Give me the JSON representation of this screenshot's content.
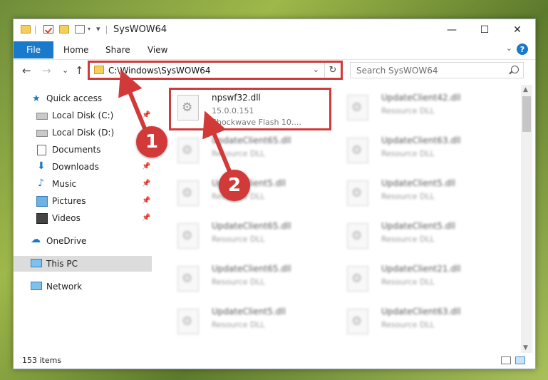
{
  "window": {
    "title": "SysWOW64",
    "controls": {
      "minimize": "—",
      "maximize": "☐",
      "close": "✕"
    }
  },
  "ribbon": {
    "tabs": [
      "File",
      "Home",
      "Share",
      "View"
    ],
    "collapse_glyph": "⌄",
    "help_glyph": "?"
  },
  "navigation": {
    "back": "←",
    "forward": "→",
    "recent": "⌄",
    "up": "↑",
    "address": "C:\\Windows\\SysWOW64",
    "address_dropdown": "⌄",
    "refresh": "↻",
    "search_placeholder": "Search SysWOW64"
  },
  "sidebar": {
    "items": [
      {
        "label": "Quick access",
        "icon": "star-icon",
        "pinned": false
      },
      {
        "label": "Local Disk (C:)",
        "icon": "drive-icon",
        "pinned": true
      },
      {
        "label": "Local Disk (D:)",
        "icon": "drive-icon",
        "pinned": false
      },
      {
        "label": "Documents",
        "icon": "document-icon",
        "pinned": false
      },
      {
        "label": "Downloads",
        "icon": "download-icon",
        "pinned": true
      },
      {
        "label": "Music",
        "icon": "music-icon",
        "pinned": true
      },
      {
        "label": "Pictures",
        "icon": "pictures-icon",
        "pinned": true
      },
      {
        "label": "Videos",
        "icon": "video-icon",
        "pinned": true
      },
      {
        "label": "OneDrive",
        "icon": "cloud-icon",
        "pinned": false
      },
      {
        "label": "This PC",
        "icon": "computer-icon",
        "pinned": false,
        "selected": true
      },
      {
        "label": "Network",
        "icon": "network-icon",
        "pinned": false
      }
    ],
    "pin_glyph": "📌"
  },
  "files": {
    "highlighted": {
      "name": "npswf32.dll",
      "version": "15.0.0.151",
      "description": "Shockwave Flash 10...."
    },
    "left_column": [
      {
        "name": "UpdateClient65.dll",
        "type": "Resource DLL"
      },
      {
        "name": "UpdateClient5.dll",
        "type": "Resource DLL"
      },
      {
        "name": "UpdateClient65.dll",
        "type": "Resource DLL"
      },
      {
        "name": "UpdateClient65.dll",
        "type": "Resource DLL"
      },
      {
        "name": "UpdateClient5.dll",
        "type": "Resource DLL"
      }
    ],
    "right_column": [
      {
        "name": "UpdateClient42.dll",
        "type": "Resource DLL"
      },
      {
        "name": "UpdateClient63.dll",
        "type": "Resource DLL"
      },
      {
        "name": "UpdateClient5.dll",
        "type": "Resource DLL"
      },
      {
        "name": "UpdateClient5.dll",
        "type": "Resource DLL"
      },
      {
        "name": "UpdateClient21.dll",
        "type": "Resource DLL"
      },
      {
        "name": "UpdateClient63.dll",
        "type": "Resource DLL"
      }
    ]
  },
  "status": {
    "item_count": "153 items"
  },
  "annotations": {
    "step1": "1",
    "step2": "2",
    "color": "#d23a3a"
  },
  "colors": {
    "accent": "#1979ca",
    "selection": "#dcdcdc"
  }
}
